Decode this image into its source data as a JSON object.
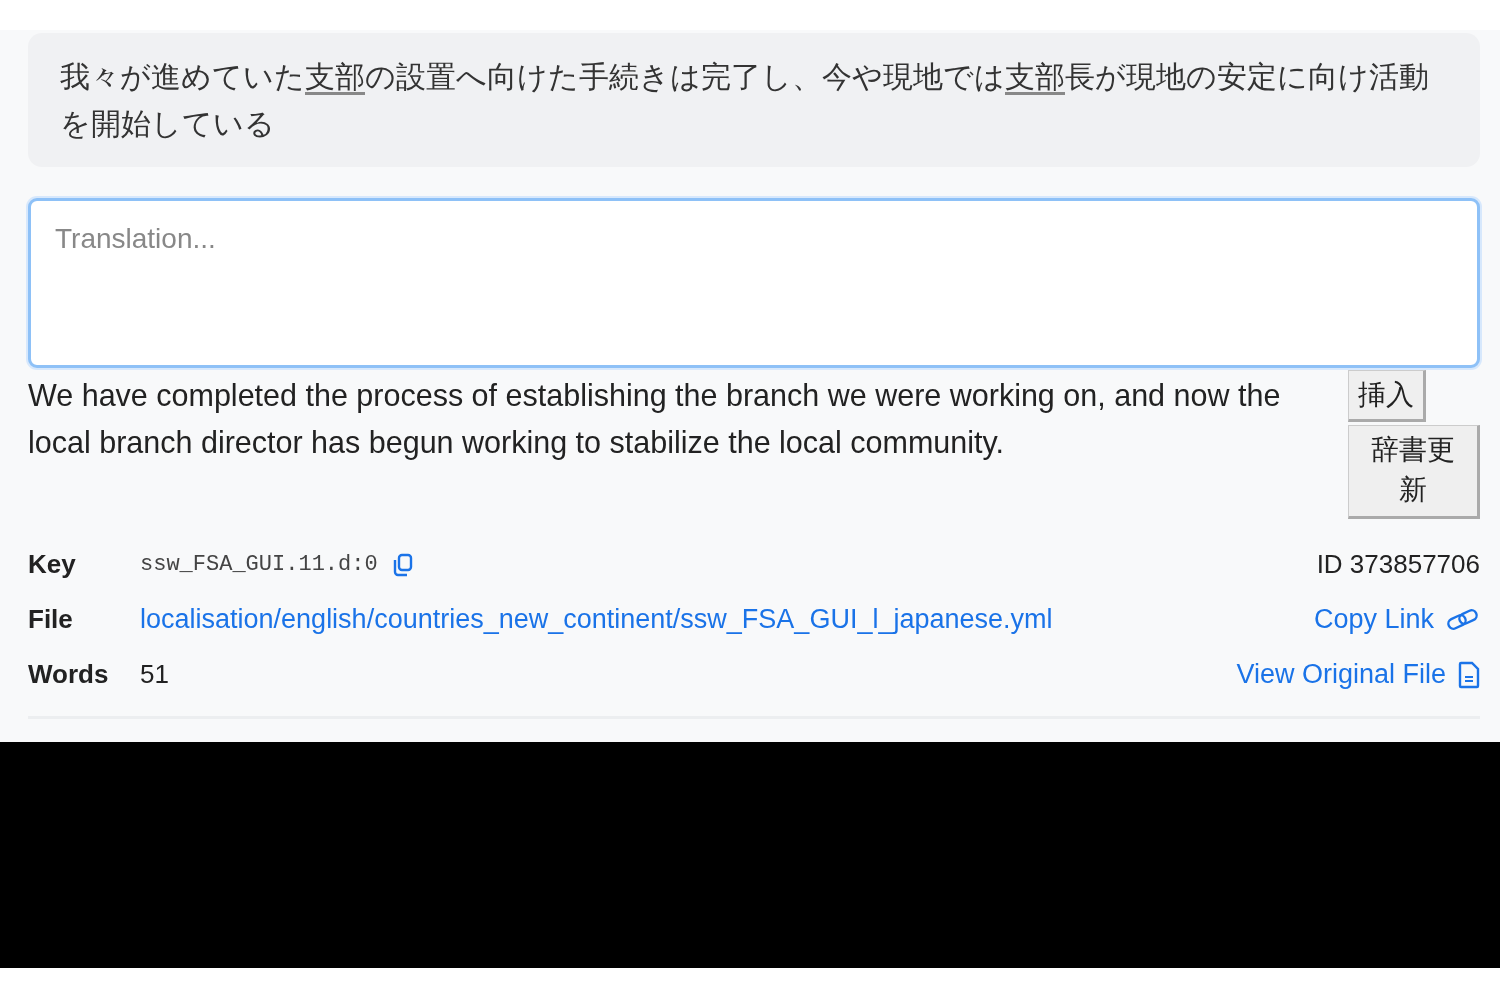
{
  "source": {
    "segments": [
      {
        "kind": "text",
        "text": "我々が進めていた"
      },
      {
        "kind": "term",
        "text": "支部"
      },
      {
        "kind": "text",
        "text": "の設置へ向けた手続きは完了し、今や現地では"
      },
      {
        "kind": "term",
        "text": "支部"
      },
      {
        "kind": "text",
        "text": "長が現地の安定に向け活動を開始している"
      }
    ]
  },
  "translation": {
    "placeholder": "Translation..."
  },
  "machine_translation": {
    "text": "We have completed the process of establishing the branch we were working on, and now the local branch director has begun working to stabilize the local community.",
    "buttons": [
      "挿入",
      "辞書更新"
    ]
  },
  "meta": {
    "rows": [
      {
        "kind": "code",
        "label": "Key",
        "value": "ssw_FSA_GUI.11.d:0"
      },
      {
        "kind": "link",
        "label": "File",
        "value": "localisation/english/countries_new_continent/ssw_FSA_GUI_l_japanese.yml"
      },
      {
        "kind": "plain",
        "label": "Words",
        "value": "51"
      }
    ],
    "side": [
      {
        "kind": "plain",
        "text": "ID 373857706"
      },
      {
        "kind": "copy-link",
        "text": "Copy Link"
      },
      {
        "kind": "file-link",
        "text": "View Original File"
      }
    ]
  }
}
